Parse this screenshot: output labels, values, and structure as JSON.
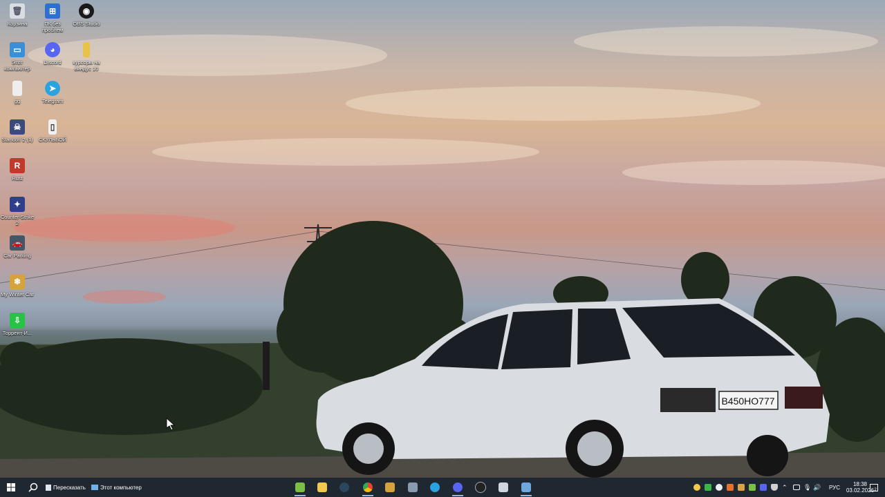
{
  "desktop": {
    "icons": [
      {
        "label": "Корзина",
        "icon": "recycle-bin-icon",
        "color": "#d8dde3"
      },
      {
        "label": "ПК без проблем",
        "icon": "pc-helper-icon",
        "color": "#2f6fd0"
      },
      {
        "label": "OBS Studio",
        "icon": "obs-icon",
        "color": "#1a1a1a"
      },
      {
        "label": "Этот компьютер",
        "icon": "this-pc-icon",
        "color": "#3a8fd6"
      },
      {
        "label": "Discord",
        "icon": "discord-icon",
        "color": "#5865f2"
      },
      {
        "label": "курсоры на виндус 10",
        "icon": "folder-icon",
        "color": "#e8c24a"
      },
      {
        "label": "gg",
        "icon": "file-icon",
        "color": "#eeeeee"
      },
      {
        "label": "Telegram",
        "icon": "telegram-icon",
        "color": "#2aa3df"
      },
      {
        "label": "Standoff 2 (1)",
        "icon": "standoff-icon",
        "color": "#3b4a7a"
      },
      {
        "label": "СКУЛЬБОЙ",
        "icon": "document-icon",
        "color": "#f0f0f0"
      },
      {
        "label": "Rust",
        "icon": "rust-icon",
        "color": "#c0392b"
      },
      {
        "label": "Counter-Strike 2",
        "icon": "cs2-icon",
        "color": "#2f3e88"
      },
      {
        "label": "Car Parking",
        "icon": "car-parking-icon",
        "color": "#445566"
      },
      {
        "label": "My Winter Car",
        "icon": "my-winter-car-icon",
        "color": "#d6a23c"
      },
      {
        "label": "Торрент-И...",
        "icon": "torrent-icon",
        "color": "#28c244"
      }
    ]
  },
  "wallpaper": {
    "plate_text": "В450НО777"
  },
  "taskbar": {
    "start_icon": "windows-start-icon",
    "search_icon": "search-icon",
    "open_windows": [
      {
        "label": "Пересказать",
        "icon": "document-app-icon"
      },
      {
        "label": "Этот компьютер",
        "icon": "this-pc-icon"
      }
    ],
    "pinned": [
      {
        "icon": "bluestacks-icon",
        "color": "#7bc043"
      },
      {
        "icon": "file-explorer-icon",
        "color": "#f2c94c"
      },
      {
        "icon": "steam-icon",
        "color": "#2a475e"
      },
      {
        "icon": "chrome-icon",
        "color": "#e94235"
      },
      {
        "icon": "roblox-studio-icon",
        "color": "#d6a23c"
      },
      {
        "icon": "car-parking-icon",
        "color": "#8a9bb0"
      },
      {
        "icon": "telegram-icon",
        "color": "#2aa3df"
      },
      {
        "icon": "discord-icon",
        "color": "#5865f2"
      },
      {
        "icon": "obs-icon",
        "color": "#222222"
      },
      {
        "icon": "onedrive-icon",
        "color": "#cfd6de"
      },
      {
        "icon": "remote-desktop-icon",
        "color": "#6fa8dc"
      }
    ],
    "tray": {
      "icons": [
        "emoji-app-icon",
        "green-app-icon",
        "yandex-icon",
        "orange-app-icon",
        "ccleaner-icon",
        "bluestacks-icon",
        "discord-icon",
        "shield-icon",
        "chevron-up-icon",
        "network-icon",
        "microphone-icon",
        "volume-icon"
      ],
      "language": "РУС",
      "time": "18:38",
      "date": "03.02.2026",
      "notification_icon": "notification-icon",
      "notification_count": "2"
    }
  }
}
